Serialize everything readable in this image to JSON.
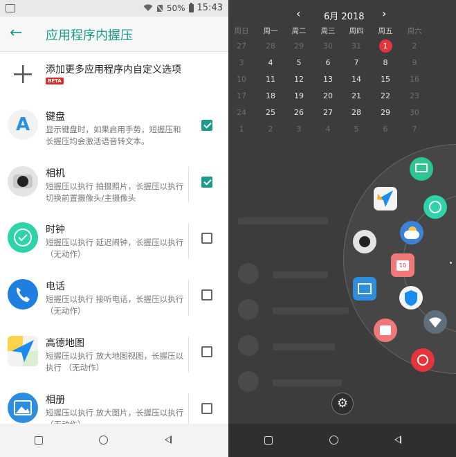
{
  "status_bar": {
    "battery": "50%",
    "time": "15:43"
  },
  "app_bar": {
    "title": "应用程序内握压"
  },
  "add_more": {
    "label": "添加更多应用程序内自定义选项",
    "badge": "BETA"
  },
  "apps": [
    {
      "name": "键盘",
      "desc": "显示键盘时，如果启用手势，短握压和长握压均会激活语音转文本。",
      "checked": true
    },
    {
      "name": "相机",
      "desc": "短握压以执行 拍摄照片，长握压以执行 切换前置摄像头/主摄像头",
      "checked": true
    },
    {
      "name": "时钟",
      "desc": "短握压以执行 延迟闹钟，长握压以执行 （无动作）",
      "checked": false
    },
    {
      "name": "电话",
      "desc": "短握压以执行 接听电话，长握压以执行 （无动作）",
      "checked": false
    },
    {
      "name": "高德地图",
      "desc": "短握压以执行 放大地图视图，长握压以执行 （无动作）",
      "checked": false
    },
    {
      "name": "相册",
      "desc": "短握压以执行 放大图片，长握压以执行 （无动作）",
      "checked": false
    }
  ],
  "calendar": {
    "month_label": "6月 2018",
    "prev": "‹",
    "next": "›",
    "weekdays": [
      "周日",
      "周一",
      "周二",
      "周三",
      "周四",
      "周五",
      "周六"
    ],
    "weeks": [
      [
        "27",
        "28",
        "29",
        "30",
        "31",
        "1",
        "2"
      ],
      [
        "3",
        "4",
        "5",
        "6",
        "7",
        "8",
        "9"
      ],
      [
        "10",
        "11",
        "12",
        "13",
        "14",
        "15",
        "16"
      ],
      [
        "17",
        "18",
        "19",
        "20",
        "21",
        "22",
        "23"
      ],
      [
        "24",
        "25",
        "26",
        "27",
        "28",
        "29",
        "30"
      ],
      [
        "1",
        "2",
        "3",
        "4",
        "5",
        "6",
        "7"
      ]
    ],
    "today": "1"
  },
  "shortcuts": [
    "messages-icon",
    "clock-icon",
    "mail-plane-icon",
    "weather-icon",
    "camera-icon",
    "calendar-icon",
    "gallery-icon",
    "security-shield-icon",
    "note-icon",
    "wifi-icon",
    "netease-music-icon"
  ],
  "colors": {
    "accent": "#1a9b8c",
    "today": "#e5343c"
  }
}
